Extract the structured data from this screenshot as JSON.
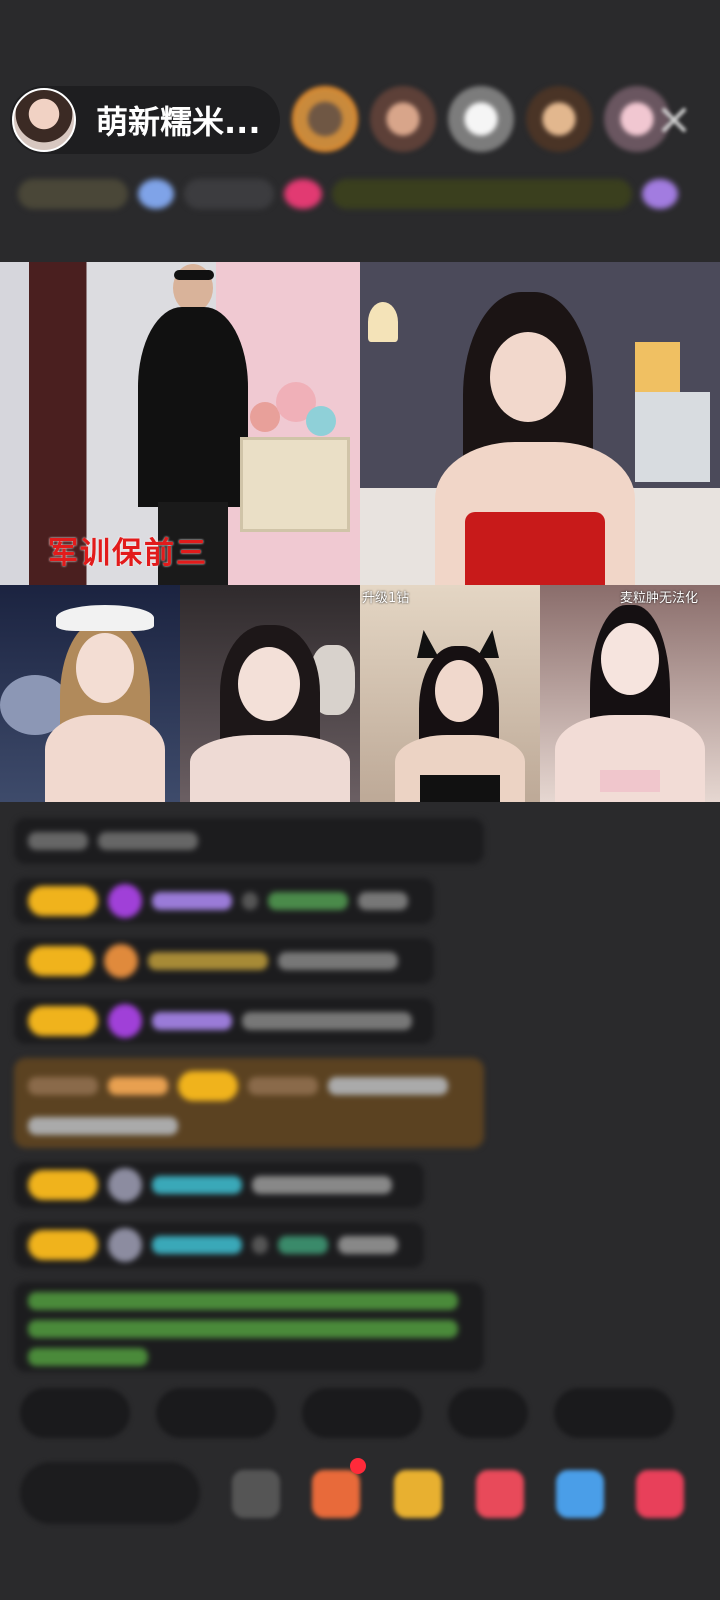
{
  "header": {
    "host_name": "萌新糯米...",
    "viewer_avatars": [
      "viewer-1",
      "viewer-2",
      "viewer-3",
      "viewer-4",
      "viewer-5"
    ],
    "close_icon": "close-icon"
  },
  "video": {
    "main_overlay_text": "军训保前三",
    "tile_tags": {
      "tile3_label": "升级1钻",
      "tile4_label": "麦粒肿无法化"
    }
  },
  "colors": {
    "badge_yellow": "#f0b31c",
    "accent_red": "#e21b1b",
    "chat_bg": "#1c1c1e"
  }
}
